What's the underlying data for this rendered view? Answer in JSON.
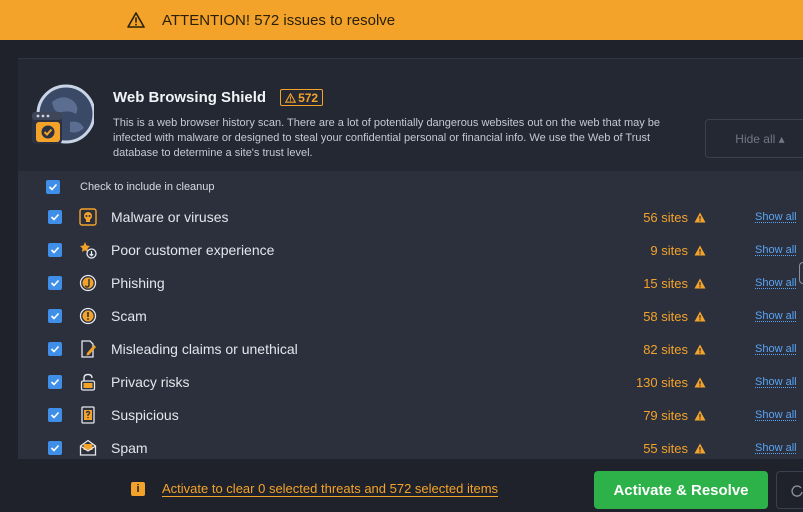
{
  "banner": {
    "text": "ATTENTION! 572 issues to resolve",
    "icon": "warning-icon"
  },
  "section": {
    "title": "Web Browsing Shield",
    "badge_count": "572",
    "description": "This is a web browser history scan. There are a lot of potentially dangerous websites out on the web that may be infected with malware or designed to steal your confidential personal or financial info. We use the Web of Trust database to determine a site's trust level.",
    "hide_button": "Hide all ▴"
  },
  "check_all_label": "Check to include in cleanup",
  "rows": [
    {
      "name": "Malware or viruses",
      "count": "56 sites",
      "icon": "skull-icon"
    },
    {
      "name": "Poor customer experience",
      "count": "9 sites",
      "icon": "bad-rating-icon"
    },
    {
      "name": "Phishing",
      "count": "15 sites",
      "icon": "phishing-hook-icon"
    },
    {
      "name": "Scam",
      "count": "58 sites",
      "icon": "exclamation-circle-icon"
    },
    {
      "name": "Misleading claims or unethical",
      "count": "82 sites",
      "icon": "document-pen-icon"
    },
    {
      "name": "Privacy risks",
      "count": "130 sites",
      "icon": "padlock-icon"
    },
    {
      "name": "Suspicious",
      "count": "79 sites",
      "icon": "question-document-icon"
    },
    {
      "name": "Spam",
      "count": "55 sites",
      "icon": "spam-envelope-icon"
    }
  ],
  "show_all_label": "Show all",
  "footer": {
    "info_icon": "i",
    "link": "Activate to clear 0 selected threats and 572 selected items",
    "primary_button": "Activate & Resolve"
  },
  "colors": {
    "accent": "#f4a32a",
    "primary": "#2db24a",
    "link": "#5aa4f5",
    "checkbox": "#3f8fe8"
  }
}
